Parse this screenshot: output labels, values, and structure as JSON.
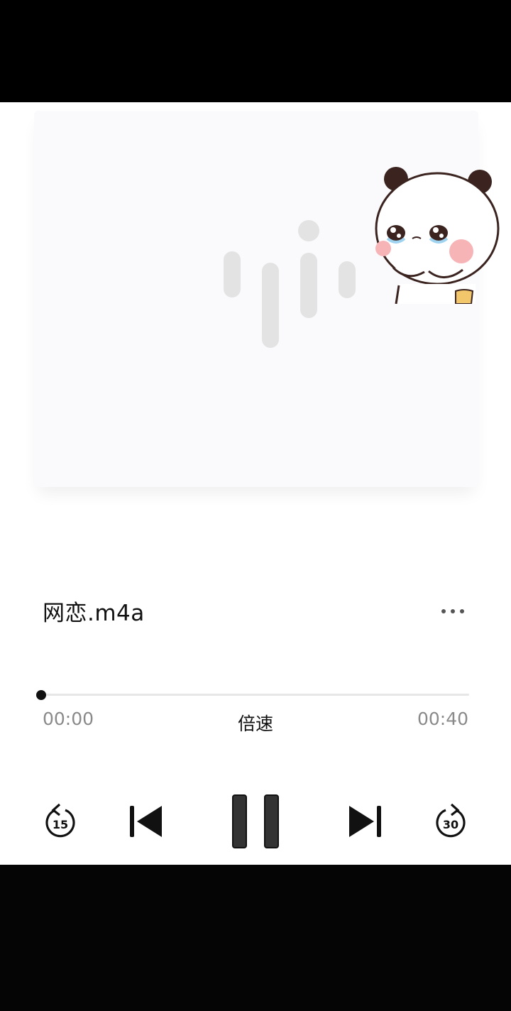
{
  "player": {
    "title": "网恋.m4a",
    "current_time": "00:00",
    "total_time": "00:40",
    "speed_label": "倍速",
    "progress": 0
  },
  "icons": {
    "waveform": "waveform-placeholder-icon",
    "sticker": "crying-panda-sticker",
    "more": "more-horizontal-icon",
    "rewind": "rewind-15-icon",
    "previous": "skip-previous-icon",
    "pause": "pause-icon",
    "next": "skip-next-icon",
    "forward": "forward-30-icon"
  },
  "controls": {
    "rewind_label": "15",
    "forward_label": "30"
  },
  "colors": {
    "background": "#ffffff",
    "accent": "#1a1a1a",
    "muted_text": "#8a8a8a",
    "wave": "#e3e3e3"
  }
}
